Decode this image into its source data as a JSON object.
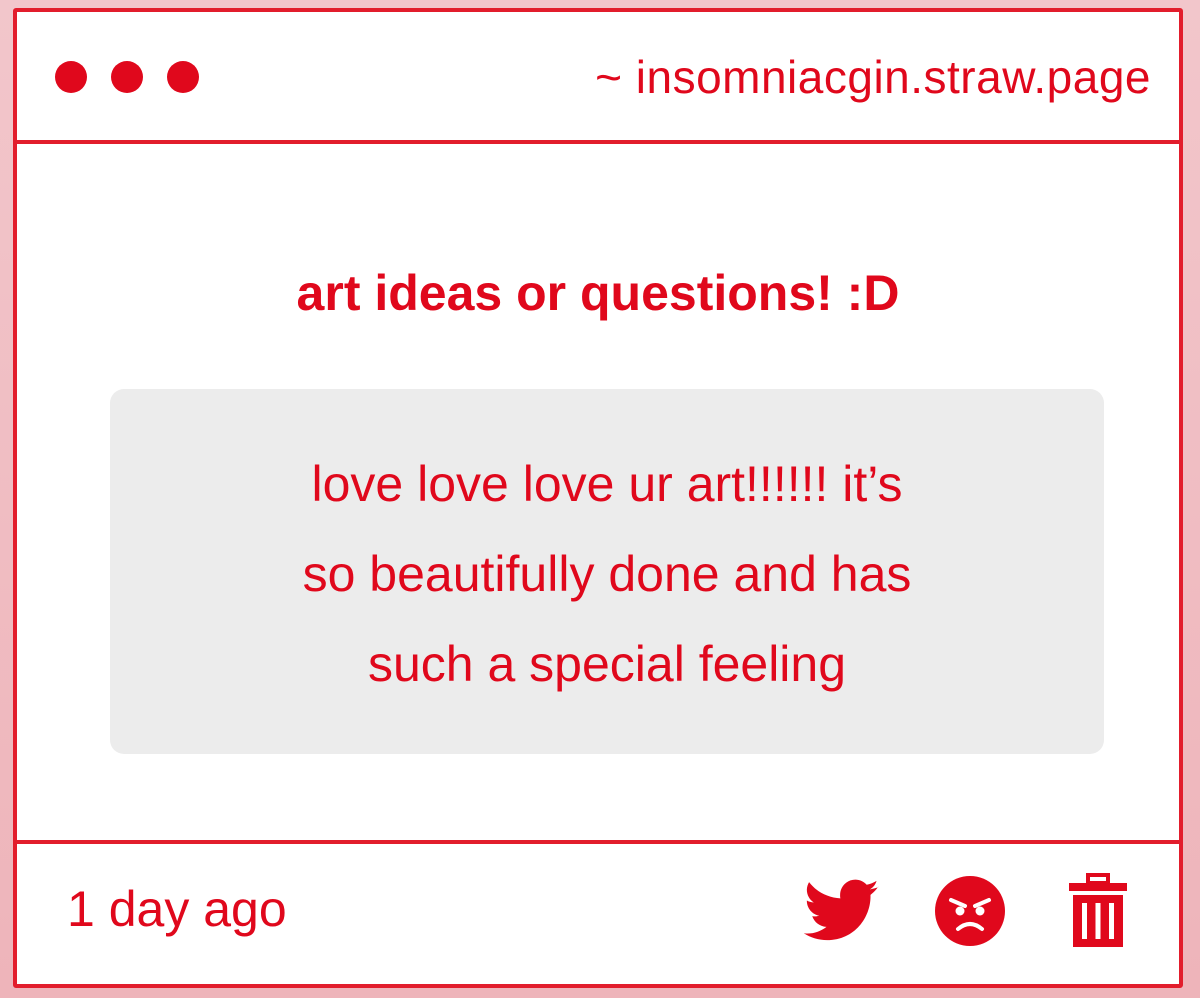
{
  "window": {
    "url": "~ insomniacgin.straw.page",
    "traffic_lights": [
      "dot",
      "dot",
      "dot"
    ]
  },
  "main": {
    "title": "art ideas or questions! :D",
    "message_lines": [
      "love love love ur art!!!!!! it’s",
      "so beautifully done and has",
      "such a special feeling"
    ]
  },
  "footer": {
    "timestamp": "1 day ago",
    "actions": [
      {
        "name": "twitter-share",
        "icon": "twitter-bird-icon"
      },
      {
        "name": "angry-reaction",
        "icon": "angry-face-icon"
      },
      {
        "name": "delete",
        "icon": "trash-icon"
      }
    ]
  },
  "colors": {
    "accent": "#e0081c",
    "message_bg": "#ececec",
    "window_bg": "#ffffff"
  }
}
